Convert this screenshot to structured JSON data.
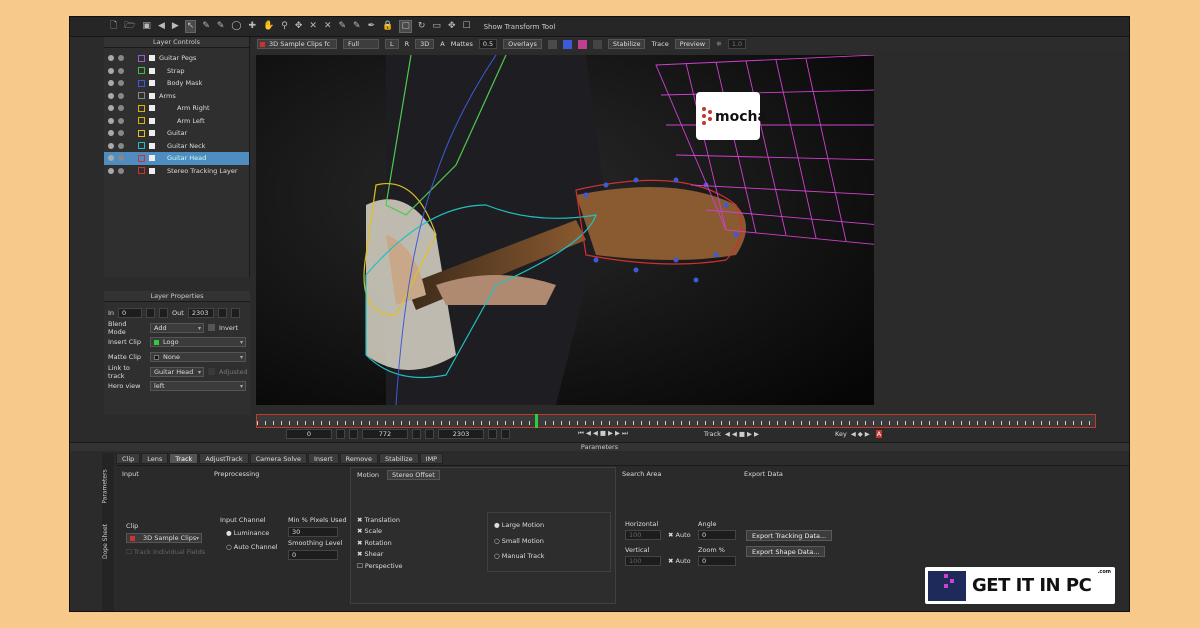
{
  "toolbar": {
    "show_transform_label": "Show Transform Tool"
  },
  "layer_controls": {
    "title": "Layer Controls",
    "layers": [
      {
        "name": "Guitar Pegs",
        "color": "#9b59d0",
        "group": true
      },
      {
        "name": "Strap",
        "color": "#3fbf3f"
      },
      {
        "name": "Body Mask",
        "color": "#3d5bd9"
      },
      {
        "name": "Arms",
        "color": "#888888",
        "group": true
      },
      {
        "name": "Arm Right",
        "color": "#e0b000"
      },
      {
        "name": "Arm Left",
        "color": "#e0b000"
      },
      {
        "name": "Guitar",
        "color": "#e0c020"
      },
      {
        "name": "Guitar Neck",
        "color": "#20c0c0"
      },
      {
        "name": "Guitar Head",
        "color": "#d03030",
        "selected": true
      },
      {
        "name": "Stereo Tracking Layer",
        "color": "#d03030"
      }
    ]
  },
  "layer_properties": {
    "title": "Layer Properties",
    "in_label": "In",
    "in_value": "0",
    "out_label": "Out",
    "out_value": "2303",
    "blend_mode_label": "Blend Mode",
    "blend_mode_value": "Add",
    "invert_label": "Invert",
    "insert_clip_label": "Insert Clip",
    "insert_clip_value": "Logo",
    "matte_clip_label": "Matte Clip",
    "matte_clip_value": "None",
    "link_to_track_label": "Link to track",
    "link_to_track_value": "Guitar Head",
    "adjusted_label": "Adjusted",
    "hero_view_label": "Hero view",
    "hero_view_value": "left"
  },
  "viewer_toolbar": {
    "clip_name": "3D Sample Clips fc",
    "resolution": "Full",
    "l_label": "L",
    "r_label": "R",
    "three_d_label": "3D",
    "a_label": "A",
    "mattes_label": "Mattes",
    "opacity_value": "0.5",
    "overlays_label": "Overlays",
    "stabilize_label": "Stabilize",
    "trace_label": "Trace",
    "preview_label": "Preview",
    "zoom_value": "1.0"
  },
  "overlay_logo": "mocha",
  "timeline": {
    "start_value": "0",
    "current_value": "772",
    "end_value": "2303",
    "track_label": "Track",
    "key_label": "Key"
  },
  "parameters": {
    "title": "Parameters",
    "side_tabs": [
      "Parameters",
      "Dope Sheet"
    ],
    "tabs": [
      "Clip",
      "Lens",
      "Track",
      "AdjustTrack",
      "Camera Solve",
      "Insert",
      "Remove",
      "Stabilize",
      "IMP"
    ],
    "active_tab": "Track",
    "input_label": "Input",
    "preprocessing_label": "Preprocessing",
    "clip_label": "Clip",
    "clip_value": "3D Sample Clips",
    "track_individual_fields": "Track Individual Fields",
    "input_channel_label": "Input Channel",
    "luminance_label": "Luminance",
    "auto_channel_label": "Auto Channel",
    "min_pixels_label": "Min % Pixels Used",
    "min_pixels_value": "30",
    "smoothing_label": "Smoothing Level",
    "smoothing_value": "0",
    "motion_tab": "Motion",
    "stereo_offset_tab": "Stereo Offset",
    "translation_label": "Translation",
    "scale_label": "Scale",
    "rotation_label": "Rotation",
    "shear_label": "Shear",
    "perspective_label": "Perspective",
    "large_motion_label": "Large Motion",
    "small_motion_label": "Small Motion",
    "manual_track_label": "Manual Track",
    "search_area_label": "Search Area",
    "horizontal_label": "Horizontal",
    "vertical_label": "Vertical",
    "horizontal_value": "100",
    "vertical_value": "100",
    "auto_label": "Auto",
    "angle_label": "Angle",
    "angle_value": "0",
    "zoom_label": "Zoom %",
    "zoom_value": "0",
    "export_data_label": "Export Data",
    "export_tracking_button": "Export Tracking Data...",
    "export_shape_button": "Export Shape Data..."
  },
  "watermark": {
    "text": "GET IT IN PC",
    "small": ".com"
  }
}
